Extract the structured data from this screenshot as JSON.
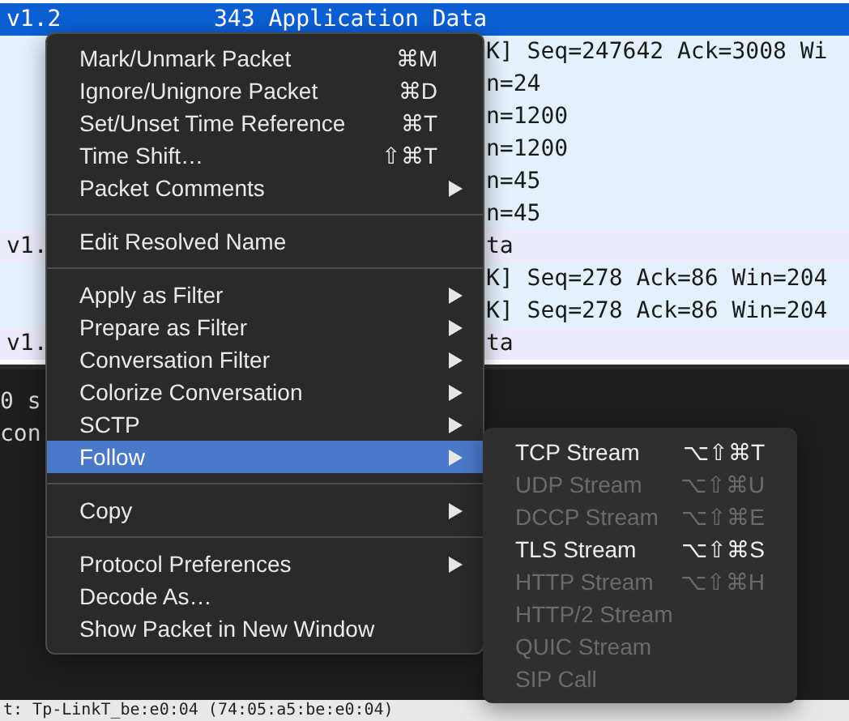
{
  "packet_list": {
    "rows": [
      {
        "selected": true,
        "col_1": "v1.2",
        "col_2": "343 Application Data"
      },
      {
        "selected": false,
        "color": "#e3f1fc",
        "col_3": "K] Seq=247642 Ack=3008 Wi"
      },
      {
        "selected": false,
        "color": "#e3f1fc",
        "col_3": "n=24"
      },
      {
        "selected": false,
        "color": "#e3f1fc",
        "col_3": "n=1200"
      },
      {
        "selected": false,
        "color": "#e3f1fc",
        "col_3": "n=1200"
      },
      {
        "selected": false,
        "color": "#e3f1fc",
        "col_3": "n=45"
      },
      {
        "selected": false,
        "color": "#e3f1fc",
        "col_3": "n=45"
      },
      {
        "selected": false,
        "color": "#ecebfa",
        "col_1": "v1.",
        "col_3": "ta"
      },
      {
        "selected": false,
        "color": "#e3f1fc",
        "col_3": "K] Seq=278 Ack=86 Win=204"
      },
      {
        "selected": false,
        "color": "#e3f1fc",
        "col_3": "K] Seq=278 Ack=86 Win=204"
      },
      {
        "selected": false,
        "color": "#ecebfa",
        "col_1": "v1.",
        "col_3": "ta"
      }
    ]
  },
  "details_pane": {
    "lines": [
      "0 s",
      "con"
    ]
  },
  "bytes_line": "t: Tp-LinkT_be:e0:04 (74:05:a5:be:e0:04)",
  "context_menu": {
    "items": [
      {
        "kind": "item",
        "label": "Mark/Unmark Packet",
        "shortcut": "⌘M",
        "submenu": false,
        "selected": false
      },
      {
        "kind": "item",
        "label": "Ignore/Unignore Packet",
        "shortcut": "⌘D",
        "submenu": false,
        "selected": false
      },
      {
        "kind": "item",
        "label": "Set/Unset Time Reference",
        "shortcut": "⌘T",
        "submenu": false,
        "selected": false
      },
      {
        "kind": "item",
        "label": "Time Shift…",
        "shortcut": "⇧⌘T",
        "submenu": false,
        "selected": false
      },
      {
        "kind": "item",
        "label": "Packet Comments",
        "submenu": true,
        "selected": false
      },
      {
        "kind": "separator"
      },
      {
        "kind": "item",
        "label": "Edit Resolved Name",
        "submenu": false,
        "selected": false
      },
      {
        "kind": "separator"
      },
      {
        "kind": "item",
        "label": "Apply as Filter",
        "submenu": true,
        "selected": false
      },
      {
        "kind": "item",
        "label": "Prepare as Filter",
        "submenu": true,
        "selected": false
      },
      {
        "kind": "item",
        "label": "Conversation Filter",
        "submenu": true,
        "selected": false
      },
      {
        "kind": "item",
        "label": "Colorize Conversation",
        "submenu": true,
        "selected": false
      },
      {
        "kind": "item",
        "label": "SCTP",
        "submenu": true,
        "selected": false
      },
      {
        "kind": "item",
        "label": "Follow",
        "submenu": true,
        "selected": true
      },
      {
        "kind": "separator"
      },
      {
        "kind": "item",
        "label": "Copy",
        "submenu": true,
        "selected": false
      },
      {
        "kind": "separator"
      },
      {
        "kind": "item",
        "label": "Protocol Preferences",
        "submenu": true,
        "selected": false
      },
      {
        "kind": "item",
        "label": "Decode As…",
        "submenu": false,
        "selected": false
      },
      {
        "kind": "item",
        "label": "Show Packet in New Window",
        "submenu": false,
        "selected": false
      }
    ]
  },
  "submenu": {
    "items": [
      {
        "label": "TCP Stream",
        "shortcut": "⌥⇧⌘T",
        "disabled": false
      },
      {
        "label": "UDP Stream",
        "shortcut": "⌥⇧⌘U",
        "disabled": true
      },
      {
        "label": "DCCP Stream",
        "shortcut": "⌥⇧⌘E",
        "disabled": true
      },
      {
        "label": "TLS Stream",
        "shortcut": "⌥⇧⌘S",
        "disabled": false
      },
      {
        "label": "HTTP Stream",
        "shortcut": "⌥⇧⌘H",
        "disabled": true
      },
      {
        "label": "HTTP/2 Stream",
        "disabled": true
      },
      {
        "label": "QUIC Stream",
        "disabled": true
      },
      {
        "label": "SIP Call",
        "disabled": true
      }
    ]
  }
}
